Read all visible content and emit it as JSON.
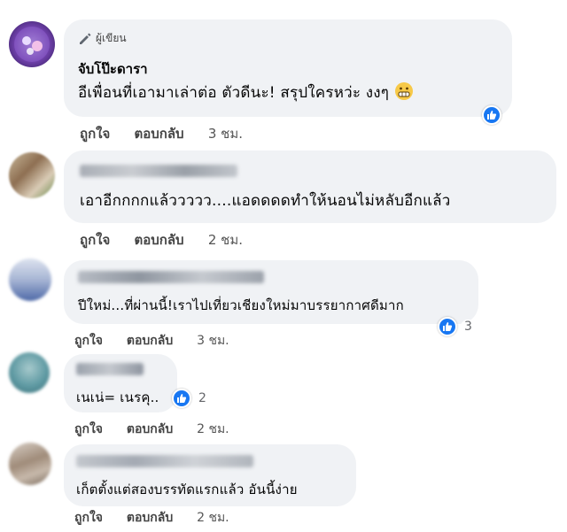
{
  "comments": [
    {
      "badge": "ผู้เขียน",
      "author": "จับโป๊ะดารา",
      "text": "อีเพื่อนที่เอามาเล่าต่อ ตัวดีนะ! สรุปใครหว่ะ งงๆ",
      "emoji_icon": "grimacing-face-icon",
      "like": "ถูกใจ",
      "reply": "ตอบกลับ",
      "time": "3 ชม.",
      "reaction_count": ""
    },
    {
      "text": "เอาอีกกกกแล้ววววว....แอดดดดทำให้นอนไม่หลับอีกแล้ว",
      "like": "ถูกใจ",
      "reply": "ตอบกลับ",
      "time": "2 ชม."
    },
    {
      "text": "ปีใหม่...ที่ผ่านนี้!เราไปเที่ยวเชียงใหม่มาบรรยากาศดีมาก",
      "like": "ถูกใจ",
      "reply": "ตอบกลับ",
      "time": "3 ชม.",
      "reaction_count": "3"
    },
    {
      "text": "เนเน่= เนรคุ..",
      "like": "ถูกใจ",
      "reply": "ตอบกลับ",
      "time": "2 ชม.",
      "reaction_count": "2"
    },
    {
      "text": "เก็ตตั้งแต่สองบรรทัดแรกแล้ว อันนี้ง่าย",
      "like": "ถูกใจ",
      "reply": "ตอบกลับ",
      "time": "2 ชม."
    }
  ],
  "colors": {
    "like_blue": "#1877f2",
    "bubble": "#f0f2f5"
  }
}
